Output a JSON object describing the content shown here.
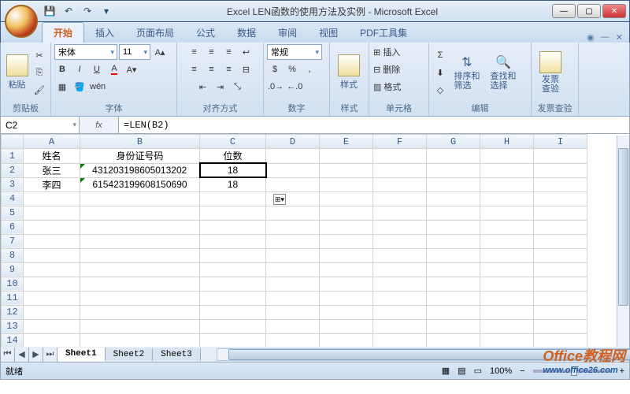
{
  "window": {
    "title": "Excel LEN函数的使用方法及实例 - Microsoft Excel"
  },
  "tabs": {
    "items": [
      "开始",
      "插入",
      "页面布局",
      "公式",
      "数据",
      "审阅",
      "视图",
      "PDF工具集"
    ],
    "active": "开始"
  },
  "ribbon": {
    "clipboard": {
      "label": "剪贴板",
      "paste": "粘贴"
    },
    "font": {
      "label": "字体",
      "name": "宋体",
      "size": "11"
    },
    "align": {
      "label": "对齐方式"
    },
    "number": {
      "label": "数字",
      "format": "常规"
    },
    "styles": {
      "label": "样式",
      "btn": "样式"
    },
    "cells": {
      "label": "单元格",
      "insert": "插入",
      "delete": "删除",
      "format": "格式"
    },
    "editing": {
      "label": "编辑",
      "sort": "排序和\n筛选",
      "find": "查找和\n选择"
    },
    "invoice": {
      "label": "发票查验",
      "btn": "发票\n查验"
    }
  },
  "formula": {
    "cell_ref": "C2",
    "fx": "fx",
    "value": "=LEN(B2)"
  },
  "columns": [
    "A",
    "B",
    "C",
    "D",
    "E",
    "F",
    "G",
    "H",
    "I"
  ],
  "rows": [
    "1",
    "2",
    "3",
    "4",
    "5",
    "6",
    "7",
    "8",
    "9",
    "10",
    "11",
    "12",
    "13",
    "14"
  ],
  "cells": {
    "A1": "姓名",
    "B1": "身份证号码",
    "C1": "位数",
    "A2": "张三",
    "B2": "431203198605013202",
    "C2": "18",
    "A3": "李四",
    "B3": "615423199608150690",
    "C3": "18"
  },
  "sheets": {
    "items": [
      "Sheet1",
      "Sheet2",
      "Sheet3"
    ],
    "active": "Sheet1"
  },
  "status": {
    "mode": "就绪",
    "zoom": "100%"
  },
  "watermark": {
    "brand": "Office教程网",
    "url": "www.office26.com"
  }
}
